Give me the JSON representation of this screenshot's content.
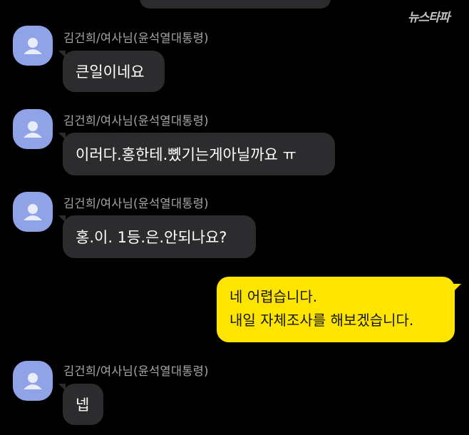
{
  "watermark": "뉴스타파",
  "messages": [
    {
      "sender": "김건희/여사님(윤석열대통령)",
      "text": "큰일이네요"
    },
    {
      "sender": "김건희/여사님(윤석열대통령)",
      "text": "이러다.홍한테.뼸기는게아닐까요 ㅠ"
    },
    {
      "sender": "김건희/여사님(윤석열대통령)",
      "text": "홍.이. 1등.은.안되나요?"
    },
    {
      "sender": "김건희/여사님(윤석열대통령)",
      "text": "넵"
    }
  ],
  "reply": {
    "line1": "네 어렵습니다.",
    "line2": "내일 자체조사를 해보겠습니다."
  },
  "colors": {
    "background": "#000000",
    "incoming_bubble": "#2c2c2f",
    "outgoing_bubble": "#fee500",
    "avatar": "#8fa3e6"
  }
}
